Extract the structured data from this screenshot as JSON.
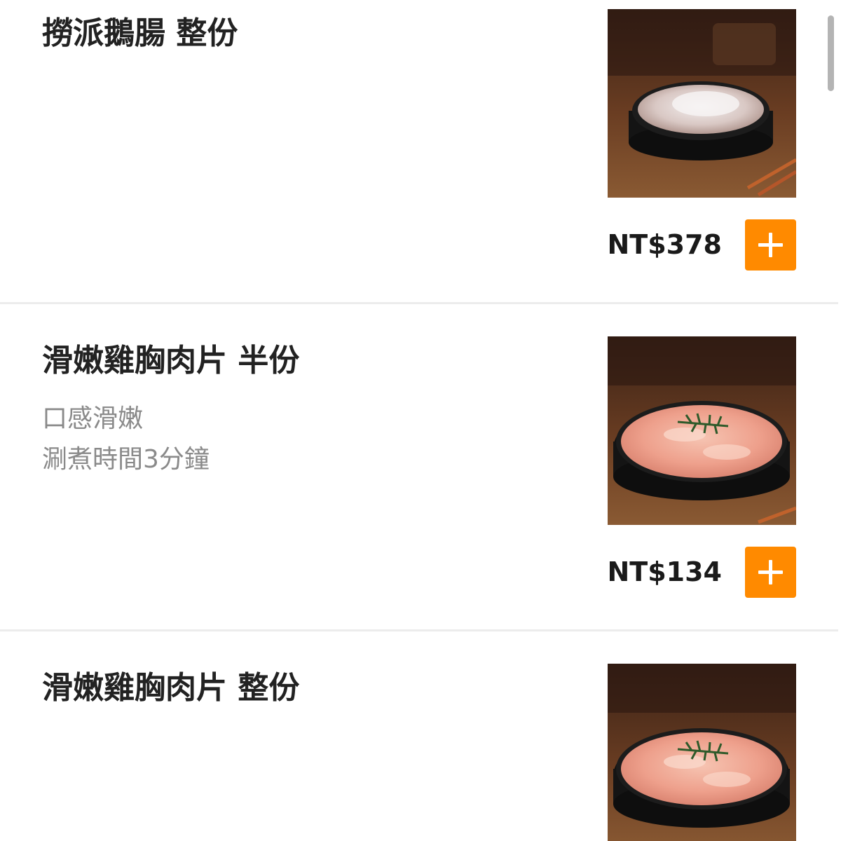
{
  "menu": {
    "items": [
      {
        "name": "撈派鵝腸 整份",
        "description": [],
        "price": "NT$378",
        "photo_alt": "撈派鵝腸 整份"
      },
      {
        "name": "滑嫩雞胸肉片 半份",
        "description": [
          "口感滑嫩",
          "涮煮時間3分鐘"
        ],
        "price": "NT$134",
        "photo_alt": "滑嫩雞胸肉片 半份"
      },
      {
        "name": "滑嫩雞胸肉片 整份",
        "description": [],
        "price": "",
        "photo_alt": "滑嫩雞胸肉片 整份"
      }
    ]
  },
  "icons": {
    "add": "plus-icon"
  },
  "colors": {
    "accent": "#ff8a00",
    "title": "#222222",
    "description": "#8a8a8a",
    "divider": "#ececec"
  }
}
